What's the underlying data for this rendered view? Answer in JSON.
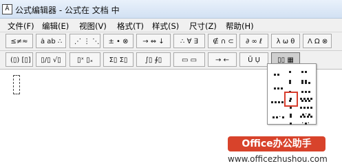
{
  "window": {
    "icon_glyph": "Ǎ",
    "title": "公式编辑器 - 公式在 文档 中"
  },
  "menu": [
    {
      "label": "文件(F)"
    },
    {
      "label": "编辑(E)"
    },
    {
      "label": "视图(V)"
    },
    {
      "label": "格式(T)"
    },
    {
      "label": "样式(S)"
    },
    {
      "label": "尺寸(Z)"
    },
    {
      "label": "帮助(H)"
    }
  ],
  "symbol_palettes": [
    {
      "label": "≤≠≈"
    },
    {
      "label": "ȧ ab ∴"
    },
    {
      "label": "⋰ ⋮ ⋱"
    },
    {
      "label": "± • ⊗"
    },
    {
      "label": "→ ⇔ ↓"
    },
    {
      "label": "∴ ∀ ∃"
    },
    {
      "label": "∉ ∩ ⊂"
    },
    {
      "label": "∂ ∞ ℓ"
    },
    {
      "label": "λ ω θ"
    },
    {
      "label": "Λ Ω ⊗"
    }
  ],
  "template_palettes": [
    {
      "label": "(▯) [▯]"
    },
    {
      "label": "▯/▯ √▯"
    },
    {
      "label": "▯ˣ ▯ₓ"
    },
    {
      "label": "Σ▯ Σ▯"
    },
    {
      "label": "∫▯ ∮▯"
    },
    {
      "label": "▭ ▭"
    },
    {
      "label": "→ ←"
    },
    {
      "label": "Ū Ụ"
    },
    {
      "label": "▯▯ ▦"
    }
  ],
  "dropdown": {
    "name": "matrix-templates",
    "selected": "vertical-3x1-grid"
  },
  "watermark": {
    "text": "Office办公助手",
    "url": "www.officezhushou.com"
  }
}
